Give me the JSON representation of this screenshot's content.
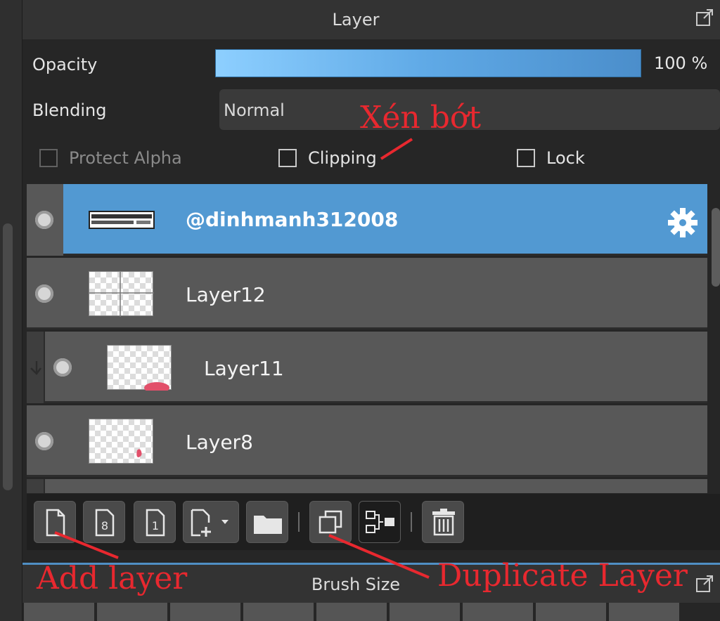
{
  "panel": {
    "title": "Layer"
  },
  "opacity": {
    "label": "Opacity",
    "value": 100,
    "value_text": "100 %"
  },
  "blending": {
    "label": "Blending",
    "selected": "Normal"
  },
  "options": {
    "protect_alpha": {
      "label": "Protect Alpha",
      "checked": false,
      "enabled": false
    },
    "clipping": {
      "label": "Clipping",
      "checked": false
    },
    "lock": {
      "label": "Lock",
      "checked": false
    }
  },
  "layers": [
    {
      "name": "@dinhmanh312008",
      "selected": true,
      "visible": true,
      "clipped": false
    },
    {
      "name": "Layer12",
      "selected": false,
      "visible": true,
      "clipped": false
    },
    {
      "name": "Layer11",
      "selected": false,
      "visible": true,
      "clipped": true
    },
    {
      "name": "Layer8",
      "selected": false,
      "visible": true,
      "clipped": false
    }
  ],
  "toolbar": {
    "buttons": [
      {
        "icon": "new-layer-icon"
      },
      {
        "icon": "new-8bit-layer-icon"
      },
      {
        "icon": "new-1bit-layer-icon"
      },
      {
        "icon": "add-layer-menu-icon"
      },
      {
        "icon": "folder-icon"
      },
      {
        "icon": "duplicate-icon"
      },
      {
        "icon": "merge-down-icon"
      },
      {
        "icon": "trash-icon"
      }
    ]
  },
  "brush_panel": {
    "title": "Brush Size"
  },
  "annotations": {
    "clipping_note": "Xén bớt",
    "add_layer_note": "Add layer",
    "duplicate_note": "Duplicate Layer"
  },
  "colors": {
    "accent": "#5299d2",
    "annotation": "#e8282f"
  }
}
